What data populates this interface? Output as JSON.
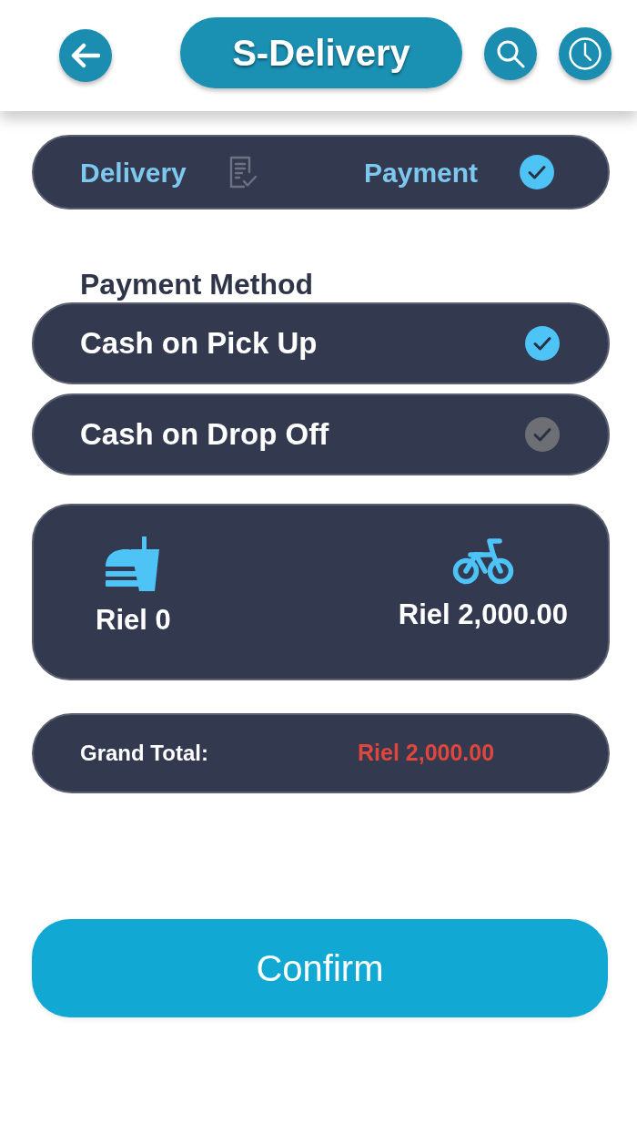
{
  "header": {
    "title": "S-Delivery"
  },
  "steps": [
    {
      "label": "Delivery",
      "selected": false
    },
    {
      "label": "Payment",
      "selected": true
    }
  ],
  "payment_method": {
    "title": "Payment Method",
    "options": [
      {
        "label": "Cash on Pick Up",
        "selected": true
      },
      {
        "label": "Cash on Drop Off",
        "selected": false
      }
    ]
  },
  "summary": {
    "items": [
      {
        "kind": "food",
        "amount": "Riel 0"
      },
      {
        "kind": "delivery",
        "amount": "Riel 2,000.00"
      }
    ]
  },
  "grand_total": {
    "label": "Grand Total:",
    "amount": "Riel 2,000.00"
  },
  "confirm_button": {
    "label": "Confirm"
  }
}
